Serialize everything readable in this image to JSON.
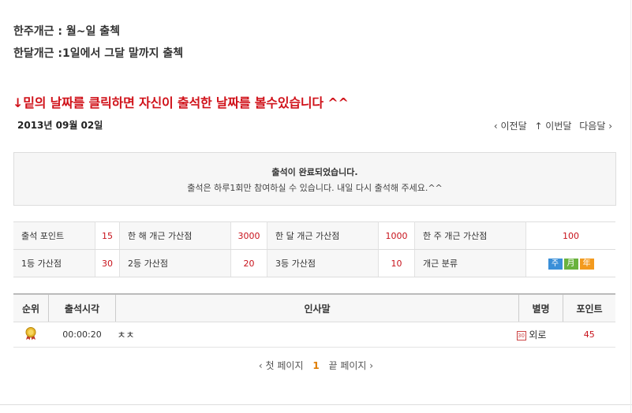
{
  "rules": {
    "week": "한주개근 : 월~일 출첵",
    "month": "한달개근 :1일에서 그달 말까지 출첵"
  },
  "notice": "↓밑의 날짜를 클릭하면 자신이 출석한 날짜를 볼수있습니다 ^^",
  "date": "2013년 09월 02일",
  "nav": {
    "prev": "‹ 이전달",
    "current": "↑ 이번달",
    "next": "다음달 ›"
  },
  "message": {
    "line1": "출석이 완료되었습니다.",
    "line2": "출석은 하루1회만 참여하실 수 있습니다. 내일 다시 출석해 주세요.^^"
  },
  "points": {
    "row1": [
      {
        "label": "출석 포인트",
        "value": "15"
      },
      {
        "label": "한 해 개근 가산점",
        "value": "3000"
      },
      {
        "label": "한 달 개근 가산점",
        "value": "1000"
      },
      {
        "label": "한 주 개근 가산점",
        "value": "100"
      }
    ],
    "row2": [
      {
        "label": "1등 가산점",
        "value": "30"
      },
      {
        "label": "2등 가산점",
        "value": "20"
      },
      {
        "label": "3등 가산점",
        "value": "10"
      },
      {
        "label": "개근 분류",
        "value": ""
      }
    ],
    "kinds": [
      {
        "label": "주",
        "color": "#3a8fd8"
      },
      {
        "label": "月",
        "color": "#6ab23e"
      },
      {
        "label": "年",
        "color": "#f39a1e"
      }
    ]
  },
  "list": {
    "headers": {
      "rank": "순위",
      "time": "출석시각",
      "greeting": "인사말",
      "nick": "별명",
      "point": "포인트"
    },
    "rows": [
      {
        "time": "00:00:20",
        "greeting": "ㅊㅊ",
        "level": "30",
        "nick": "외로",
        "point": "45"
      }
    ]
  },
  "paging": {
    "first": "‹ 첫 페이지",
    "current": "1",
    "last": "끝 페이지 ›"
  }
}
